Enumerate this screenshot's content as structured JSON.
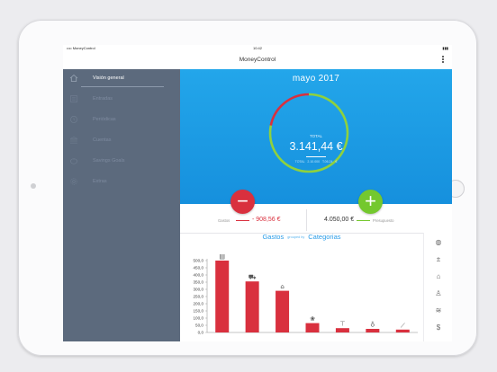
{
  "status": {
    "left": "•••• MoneyControl",
    "time": "10:42",
    "right": "▮▮▮"
  },
  "app": {
    "title": "MoneyControl"
  },
  "sidebar": {
    "items": [
      {
        "label": "Visión general",
        "icon": "home-icon"
      },
      {
        "label": "Entradas",
        "icon": "list-icon"
      },
      {
        "label": "Periódicas",
        "icon": "clock-icon"
      },
      {
        "label": "Cuentas",
        "icon": "bank-icon"
      },
      {
        "label": "Savings Goals",
        "icon": "savings-icon"
      },
      {
        "label": "Extras",
        "icon": "gear-icon"
      }
    ]
  },
  "dashboard": {
    "month": "mayo 2017",
    "total_label": "TOTAL",
    "total_value": "3.141,44 €",
    "total_sub": "TOTAL 2.10.000   T.06.24 €",
    "ring_fraction": 0.78,
    "ring_colors": {
      "main": "#8fd13d",
      "rest": "#d9303e"
    }
  },
  "summary": {
    "gastos_label": "Gastos",
    "gastos_value": "- 908,56 €",
    "budget_value": "4.050,00 €",
    "budget_label": "Presupuesto"
  },
  "chart_header": {
    "left": "Gastos",
    "middle": "grouped by",
    "right": "Categorias"
  },
  "chart_data": {
    "type": "bar",
    "categories": [
      "Comidas",
      "Coche",
      "Hogar",
      "Mascotas",
      "Ropa",
      "Regalos",
      "Salud"
    ],
    "category_icons": [
      "receipt-icon",
      "car-icon",
      "house-icon",
      "paw-icon",
      "shirt-icon",
      "gift-icon",
      "medicine-icon"
    ],
    "values": [
      500,
      355,
      290,
      65,
      30,
      25,
      20
    ],
    "ylim": [
      0,
      500
    ],
    "yticks": [
      "0,0",
      "50,0",
      "100,0",
      "150,0",
      "200,0",
      "250,0",
      "300,0",
      "350,0",
      "400,0",
      "450,0",
      "500,0"
    ],
    "bar_color": "#d9303e"
  },
  "right_icons": [
    "globe-icon",
    "plus-minus-icon",
    "tag-icon",
    "person-icon",
    "layers-icon",
    "dollar-icon"
  ],
  "right_glyphs": [
    "◍",
    "±",
    "⌂",
    "♙",
    "≋",
    "$"
  ]
}
